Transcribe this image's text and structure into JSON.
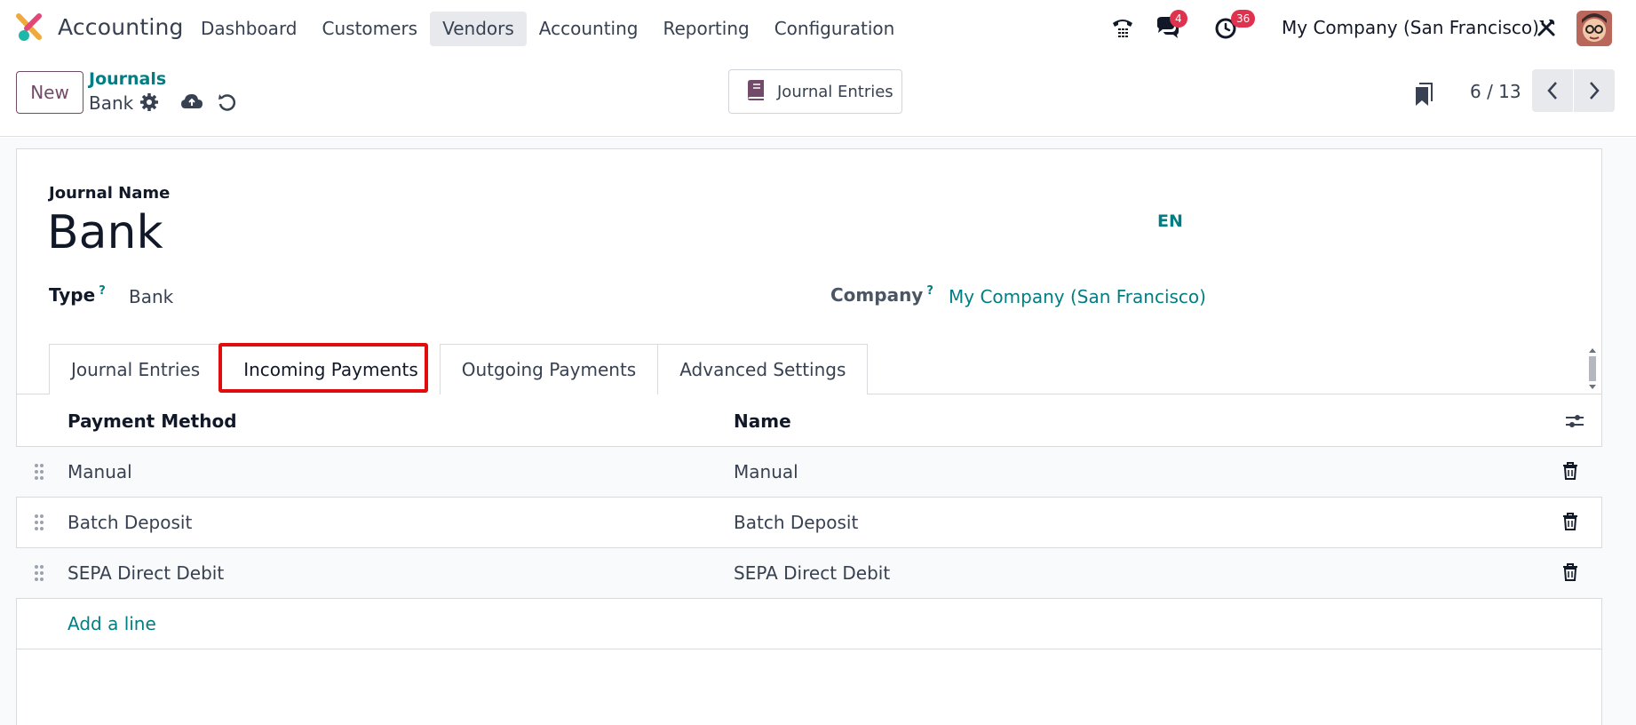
{
  "app": {
    "name": "Accounting",
    "menu": [
      "Dashboard",
      "Customers",
      "Vendors",
      "Accounting",
      "Reporting",
      "Configuration"
    ],
    "active_menu": "Vendors",
    "messages_badge": "4",
    "activities_badge": "36",
    "company": "My Company (San Francisco)"
  },
  "control": {
    "new_label": "New",
    "breadcrumb_parent": "Journals",
    "breadcrumb_current": "Bank",
    "smart_button": "Journal Entries",
    "pager": "6 / 13"
  },
  "form": {
    "name_label": "Journal Name",
    "name_value": "Bank",
    "lang": "EN",
    "type_label": "Type",
    "type_value": "Bank",
    "company_label": "Company",
    "company_value": "My Company (San Francisco)",
    "help_mark": "?"
  },
  "tabs": [
    {
      "label": "Journal Entries"
    },
    {
      "label": "Incoming Payments"
    },
    {
      "label": "Outgoing Payments"
    },
    {
      "label": "Advanced Settings"
    }
  ],
  "table": {
    "headers": {
      "method": "Payment Method",
      "name": "Name"
    },
    "rows": [
      {
        "method": "Manual",
        "name": "Manual"
      },
      {
        "method": "Batch Deposit",
        "name": "Batch Deposit"
      },
      {
        "method": "SEPA Direct Debit",
        "name": "SEPA Direct Debit"
      }
    ],
    "add_line": "Add a line"
  },
  "colors": {
    "brand": "#714b67",
    "link": "#017e84",
    "highlight": "#e00d0d",
    "badge": "#e0314e"
  }
}
